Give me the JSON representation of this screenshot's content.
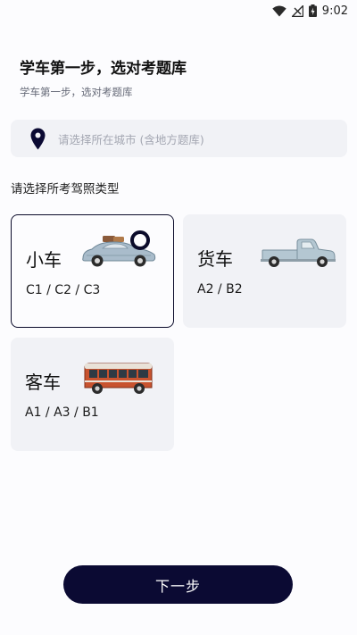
{
  "status_bar": {
    "time": "9:02",
    "icons": [
      "wifi-icon",
      "signal-icon",
      "battery-icon"
    ]
  },
  "header": {
    "title": "学车第一步，选对考题库",
    "subtitle": "学车第一步，选对考题库"
  },
  "city_select": {
    "placeholder": "请选择所在城市 (含地方题库)",
    "icon": "location-pin-icon"
  },
  "license_section": {
    "label": "请选择所考驾照类型"
  },
  "license_types": [
    {
      "title": "小车",
      "codes": "C1 / C2 / C3",
      "selected": true
    },
    {
      "title": "货车",
      "codes": "A2 / B2",
      "selected": false
    },
    {
      "title": "客车",
      "codes": "A1 / A3 / B1",
      "selected": false
    }
  ],
  "next_button": {
    "label": "下一步"
  },
  "colors": {
    "primary": "#0b0a33",
    "card_bg": "#f1f2f6",
    "placeholder": "#a4a7b2"
  }
}
